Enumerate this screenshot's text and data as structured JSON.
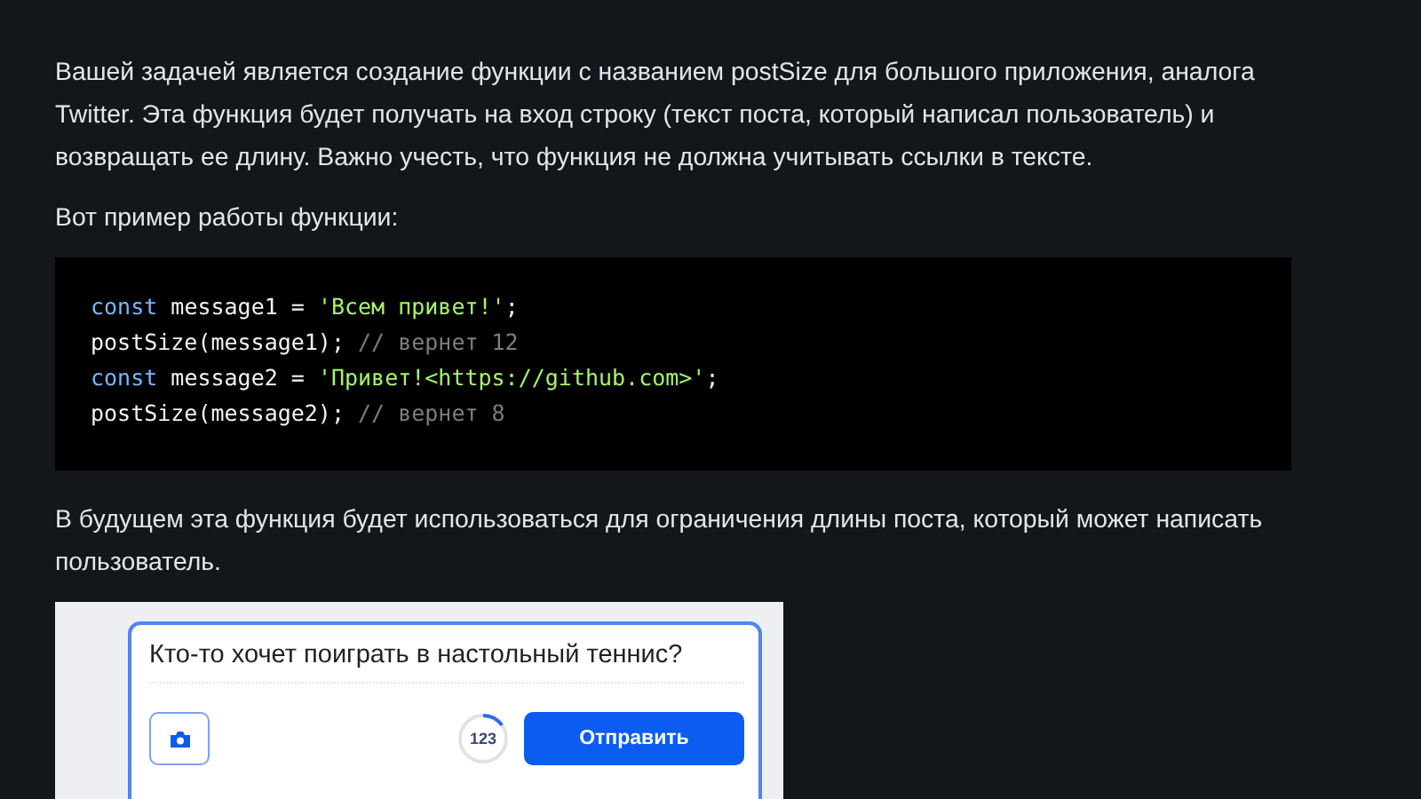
{
  "paragraphs_top": [
    "Вашей задачей является создание функции с названием postSize для большого приложения, аналога Twitter. Эта функция будет получать на вход строку (текст поста, который написал пользователь) и возвращать ее длину. Важно учесть, что функция не должна учитывать ссылки в тексте.",
    "Вот пример работы функции:"
  ],
  "code": {
    "lines": [
      [
        {
          "kind": "keyword",
          "text": "const"
        },
        {
          "kind": "plain",
          "text": " message1 = "
        },
        {
          "kind": "string",
          "text": "'Всем привет!'"
        },
        {
          "kind": "plain",
          "text": ";"
        }
      ],
      [
        {
          "kind": "plain",
          "text": "postSize(message1); "
        },
        {
          "kind": "comment",
          "text": "// вернет 12"
        }
      ],
      [
        {
          "kind": "keyword",
          "text": "const"
        },
        {
          "kind": "plain",
          "text": " message2 = "
        },
        {
          "kind": "string",
          "text": "'Привет!<https://github.com>'"
        },
        {
          "kind": "plain",
          "text": ";"
        }
      ],
      [
        {
          "kind": "plain",
          "text": "postSize(message2); "
        },
        {
          "kind": "comment",
          "text": "// вернет 8"
        }
      ]
    ]
  },
  "paragraphs_bottom": [
    "В будущем эта функция будет использоваться для ограничения длины поста, который может написать пользователь."
  ],
  "post_form": {
    "text": "Кто-то хочет поиграть в настольный теннис?",
    "counter": {
      "text": "123",
      "level": 0.15
    },
    "submit": "Отправить"
  }
}
